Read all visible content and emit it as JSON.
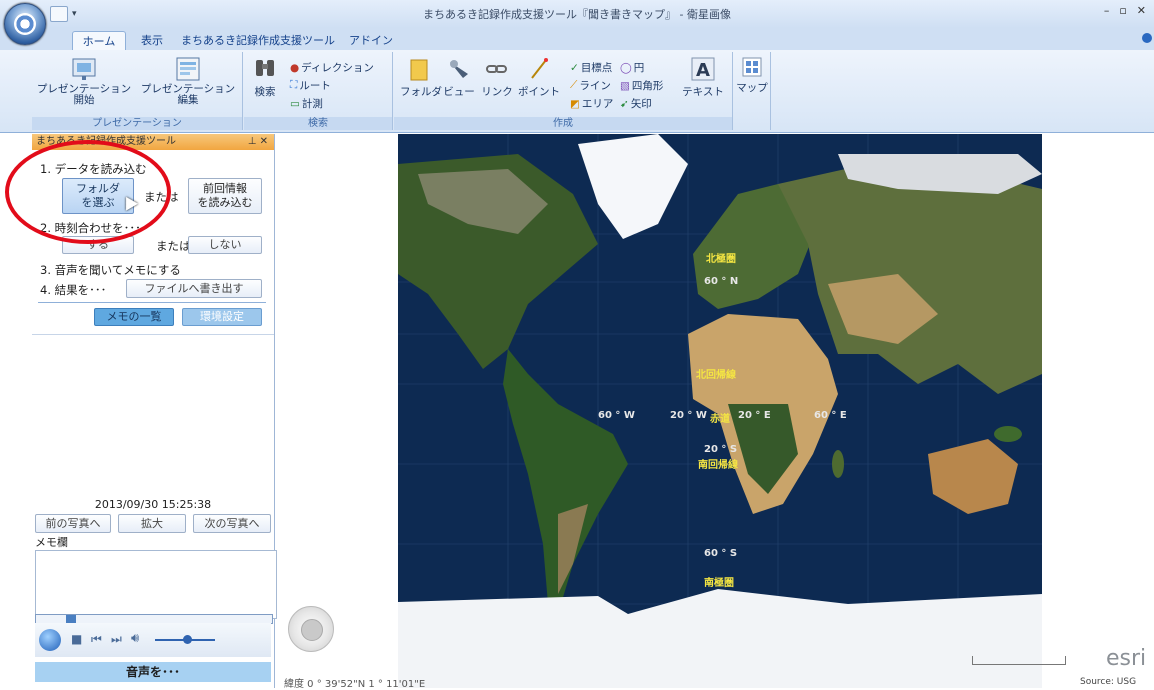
{
  "window": {
    "title": "まちあるき記録作成支援ツール『聞き書きマップ』 - 衛星画像"
  },
  "tabs": [
    {
      "label": "ホーム",
      "active": true
    },
    {
      "label": "表示"
    },
    {
      "label": "まちあるき記録作成支援ツール"
    },
    {
      "label": "アドイン"
    }
  ],
  "ribbon": {
    "presentation": {
      "start_label": "プレゼンテーション\n開始",
      "edit_label": "プレゼンテーション\n編集",
      "group_label": "プレゼンテーション"
    },
    "search": {
      "search_label": "検索",
      "direction_label": "ディレクション",
      "route_label": "ルート",
      "measure_label": "計測",
      "group_label": "検索"
    },
    "create": {
      "folder_label": "フォルダ",
      "view_label": "ビュー",
      "link_label": "リンク",
      "point_label": "ポイント",
      "target_label": "目標点",
      "line_label": "ライン",
      "area_label": "エリア",
      "circle_label": "円",
      "rectangle_label": "四角形",
      "arrow_label": "矢印",
      "text_label": "テキスト",
      "group_label": "作成"
    },
    "map": {
      "map_label": "マップ"
    }
  },
  "panel": {
    "header": "まちあるき記録作成支援ツール",
    "step1": "1. データを読み込む",
    "select_folder": "フォルダ\nを選ぶ",
    "or1": "または",
    "load_previous": "前回情報\nを読み込む",
    "step2": "2. 時刻合わせを･･･",
    "do": "する",
    "or2": "または",
    "dont": "しない",
    "step3": "3. 音声を聞いてメモにする",
    "step4": "4. 結果を･･･",
    "write_file": "ファイルへ書き出す",
    "memo_list": "メモの一覧",
    "settings": "環境設定",
    "timestamp": "2013/09/30 15:25:38",
    "prev_photo": "前の写真へ",
    "zoom": "拡大",
    "next_photo": "次の写真へ",
    "memo_label": "メモ欄",
    "memo_value": "",
    "sound_label": "音声を･･･"
  },
  "map": {
    "arctic_circle": "北極圏",
    "lat_60n": "60 ° N",
    "tropic_cancer": "北回帰線",
    "lon_60w": "60 ° W",
    "lon_20w": "20 ° W",
    "equator": "赤道",
    "lon_20e": "20 ° E",
    "lon_60e": "60 ° E",
    "lat_20s": "20 ° S",
    "tropic_capricorn": "南回帰線",
    "lat_60s": "60 ° S",
    "antarctic_circle": "南極圏",
    "coords": "緯度 0 ° 39'52\"N  1 ° 11'01\"E",
    "brand": "esri",
    "source": "Source: USG"
  },
  "colors": {
    "accent": "#15428b",
    "ocean": "#0d2a52",
    "highlight_circle": "#e20c1a",
    "panel_header": "#f1a640",
    "sound_bar": "#a7d1f2"
  }
}
